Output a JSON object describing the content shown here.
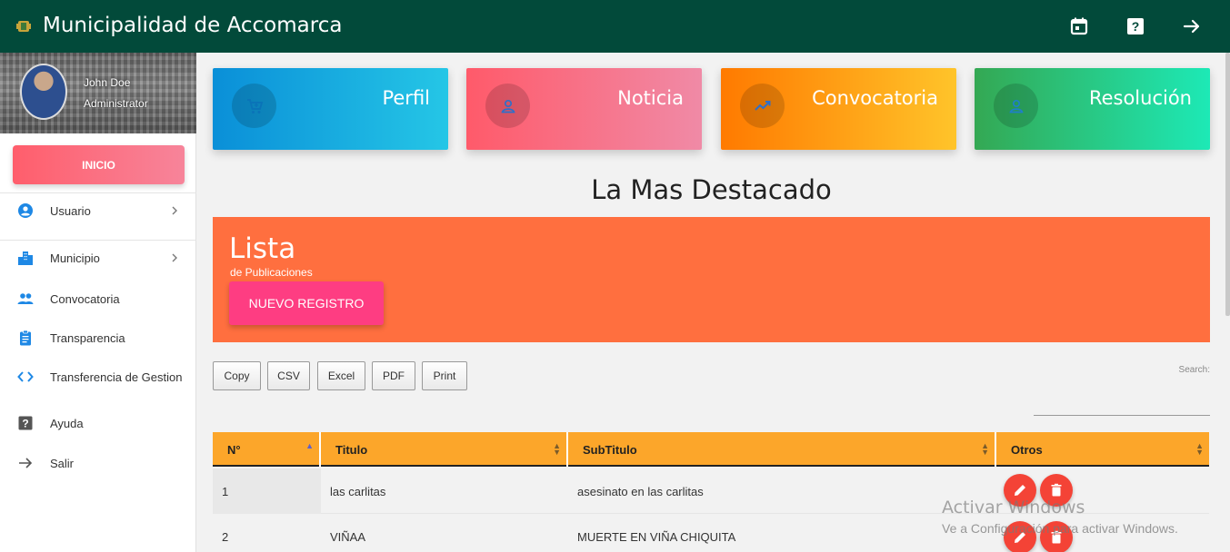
{
  "app": {
    "title": "Municipalidad de Accomarca"
  },
  "topbar": {
    "icons": [
      {
        "name": "calendar-icon"
      },
      {
        "name": "help-icon"
      },
      {
        "name": "arrow-right-icon"
      }
    ]
  },
  "sidebar": {
    "user_name": "John Doe",
    "user_role": "Administrator",
    "inicio_label": "INICIO",
    "items": [
      {
        "label": "Usuario",
        "icon": "account-circle-icon",
        "has_children": true
      },
      {
        "label": "Municipio",
        "icon": "buildings-icon",
        "has_children": true
      },
      {
        "label": "Convocatoria",
        "icon": "people-icon",
        "has_children": false
      },
      {
        "label": "Transparencia",
        "icon": "clipboard-icon",
        "has_children": false
      },
      {
        "label": "Transferencia de Gestion",
        "icon": "code-icon",
        "has_children": false
      },
      {
        "label": "Ayuda",
        "icon": "help-icon",
        "has_children": false
      },
      {
        "label": "Salir",
        "icon": "arrow-right-icon",
        "has_children": false
      }
    ]
  },
  "cards": [
    {
      "title": "Perfil",
      "icon": "cart-icon",
      "color_from": "#0a8fd8",
      "color_to": "#25c6e6"
    },
    {
      "title": "Noticia",
      "icon": "person-icon",
      "color_from": "#ff5a6a",
      "color_to": "#f08aa6"
    },
    {
      "title": "Convocatoria",
      "icon": "trending-icon",
      "color_from": "#ff7a00",
      "color_to": "#ffc42a"
    },
    {
      "title": "Resolución",
      "icon": "person-icon",
      "color_from": "#34a853",
      "color_to": "#1de9b6"
    }
  ],
  "main": {
    "headline": "La Mas Destacado",
    "panel_title": "Lista",
    "panel_subtitle": "de Publicaciones",
    "new_button": "NUEVO REGISTRO",
    "export_buttons": [
      "Copy",
      "CSV",
      "Excel",
      "PDF",
      "Print"
    ],
    "search_label": "Search:",
    "search_value": ""
  },
  "table": {
    "columns": [
      "N°",
      "Titulo",
      "SubTitulo",
      "Otros"
    ],
    "rows": [
      {
        "n": "1",
        "titulo": "las carlitas",
        "subtitulo": "asesinato en las carlitas"
      },
      {
        "n": "2",
        "titulo": "VIÑAA",
        "subtitulo": "MUERTE EN VIÑA CHIQUITA"
      }
    ]
  },
  "watermark": {
    "line1": "Activar Windows",
    "line2": "Ve a Configuración para activar Windows."
  }
}
